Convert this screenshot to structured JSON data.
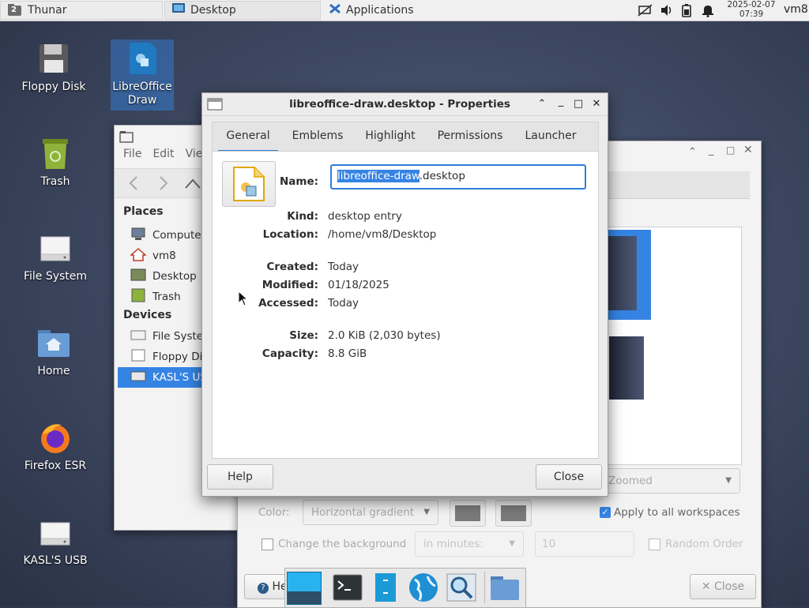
{
  "panel": {
    "tasks": [
      {
        "label": "Thunar",
        "badge": "2",
        "icon": "folder-icon"
      },
      {
        "label": "Desktop",
        "icon": "desktop-icon"
      },
      {
        "label": "Applications",
        "icon": "xfce-logo-icon"
      }
    ],
    "clock_date": "2025-02-07",
    "clock_time": "07:39",
    "user": "vm8"
  },
  "desktop_icons": [
    {
      "label": "Floppy Disk",
      "icon": "floppy-icon"
    },
    {
      "label": "LibreOffice Draw",
      "icon": "libreoffice-draw-icon"
    },
    {
      "label": "Trash",
      "icon": "trash-icon"
    },
    {
      "label": "File System",
      "icon": "drive-icon"
    },
    {
      "label": "Home",
      "icon": "home-folder-icon"
    },
    {
      "label": "Firefox ESR",
      "icon": "firefox-icon"
    },
    {
      "label": "KASL'S USB",
      "icon": "usb-drive-icon"
    }
  ],
  "thunar": {
    "menu": [
      "File",
      "Edit",
      "Vie"
    ],
    "places_header": "Places",
    "places": [
      "Computer",
      "vm8",
      "Desktop",
      "Trash"
    ],
    "devices_header": "Devices",
    "devices": [
      "File Syste",
      "Floppy Di",
      "KASL'S US"
    ]
  },
  "desktop_settings": {
    "style_value": "Zoomed",
    "color_label": "Color:",
    "color_value": "Horizontal gradient",
    "apply_all_label": "Apply to all workspaces",
    "apply_all_checked": true,
    "change_bg_label": "Change the background",
    "interval_value": "in minutes:",
    "interval_number": "10",
    "random_label": "Random Order",
    "help_label": "He",
    "close_label": "Close"
  },
  "dialog": {
    "title": "libreoffice-draw.desktop - Properties",
    "tabs": [
      "General",
      "Emblems",
      "Highlight",
      "Permissions",
      "Launcher"
    ],
    "active_tab": "General",
    "name_label": "Name:",
    "name_selected": "libreoffice-draw",
    "name_rest": ".desktop",
    "fields": [
      {
        "label": "Kind:",
        "value": "desktop entry"
      },
      {
        "label": "Location:",
        "value": "/home/vm8/Desktop"
      },
      {
        "label": "Created:",
        "value": "Today"
      },
      {
        "label": "Modified:",
        "value": "01/18/2025"
      },
      {
        "label": "Accessed:",
        "value": "Today"
      },
      {
        "label": "Size:",
        "value": "2.0 KiB (2,030 bytes)"
      },
      {
        "label": "Capacity:",
        "value": "8.8 GiB"
      }
    ],
    "help_button": "Help",
    "close_button": "Close"
  },
  "colors": {
    "accent": "#2f7fd6",
    "selection": "#3584e4"
  }
}
